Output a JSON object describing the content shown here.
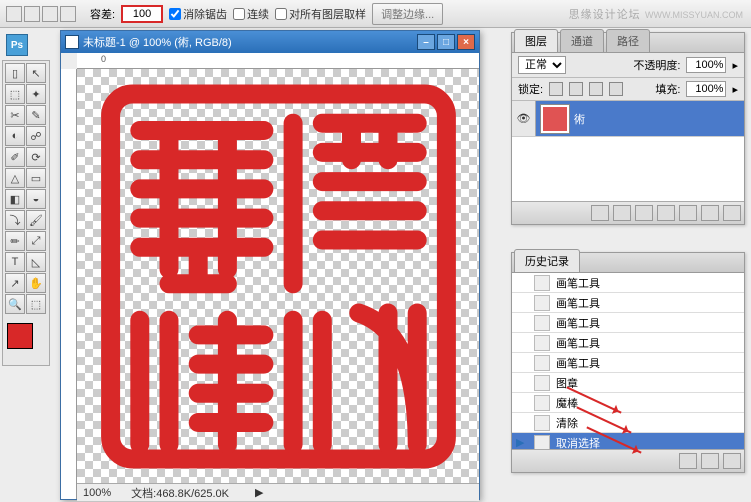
{
  "topbar": {
    "tolerance_label": "容差:",
    "tolerance_value": "100",
    "antialias": "消除锯齿",
    "contiguous": "连续",
    "sample_all": "对所有图层取样",
    "refine_btn": "调整边缘..."
  },
  "watermark": {
    "site": "思缘设计论坛",
    "url": "WWW.MISSYUAN.COM"
  },
  "ps_badge": "Ps",
  "doc": {
    "title": "未标题-1 @ 100% (術, RGB/8)",
    "zoom": "100%",
    "file_label": "文档:",
    "file_info": "468.8K/625.0K"
  },
  "layers": {
    "tabs": [
      "图层",
      "通道",
      "路径"
    ],
    "blend_mode": "正常",
    "opacity_label": "不透明度:",
    "opacity_value": "100%",
    "lock_label": "锁定:",
    "fill_label": "填充:",
    "fill_value": "100%",
    "items": [
      {
        "name": "術"
      }
    ]
  },
  "history": {
    "tab": "历史记录",
    "items": [
      {
        "name": "画笔工具",
        "selected": false
      },
      {
        "name": "画笔工具",
        "selected": false
      },
      {
        "name": "画笔工具",
        "selected": false
      },
      {
        "name": "画笔工具",
        "selected": false
      },
      {
        "name": "画笔工具",
        "selected": false
      },
      {
        "name": "图章",
        "selected": false
      },
      {
        "name": "魔棒",
        "selected": false
      },
      {
        "name": "清除",
        "selected": false
      },
      {
        "name": "取消选择",
        "selected": true
      }
    ]
  },
  "tools": [
    "▯",
    "↖",
    "⬚",
    "✦",
    "✂",
    "✎",
    "◐",
    "☍",
    "✐",
    "⟳",
    "△",
    "▭",
    "◧",
    "◒",
    "⤵",
    "🖌",
    "✏",
    "⤢",
    "T",
    "◺",
    "↗",
    "✋",
    "🔍",
    "⬚"
  ]
}
